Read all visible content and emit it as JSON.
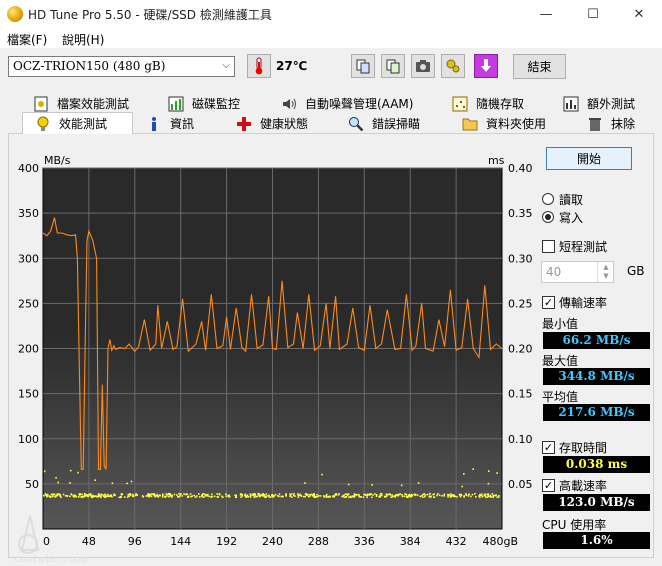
{
  "window": {
    "title": "HD Tune Pro 5.50 - 硬碟/SSD 檢測維護工具",
    "minimize": "—",
    "maximize": "☐",
    "close": "✕"
  },
  "menu": [
    "檔案(F)",
    "說明(H)"
  ],
  "toolbar": {
    "drive": "OCZ-TRION150 (480 gB)",
    "temperature": "27℃",
    "exit_label": "結束"
  },
  "tabs_top": [
    "檔案效能測試",
    "磁碟監控",
    "自動噪聲管理(AAM)",
    "隨機存取",
    "額外測試"
  ],
  "tabs_bottom": [
    "效能測試",
    "資訊",
    "健康狀態",
    "錯誤掃瞄",
    "資料夾使用",
    "抹除"
  ],
  "chart": {
    "left_unit": "MB/s",
    "right_unit": "ms",
    "y_left_ticks": [
      "400",
      "350",
      "300",
      "250",
      "200",
      "150",
      "100",
      "50"
    ],
    "y_right_ticks": [
      "0.40",
      "0.35",
      "0.30",
      "0.25",
      "0.20",
      "0.15",
      "0.10",
      "0.05"
    ],
    "x_ticks": [
      "0",
      "48",
      "96",
      "144",
      "192",
      "240",
      "288",
      "336",
      "384",
      "432",
      "480gB"
    ]
  },
  "chart_data": {
    "type": "line",
    "x_range": [
      0,
      480
    ],
    "x_unit": "gB",
    "y_left_range": [
      0,
      400
    ],
    "y_right_range": [
      0,
      0.4
    ],
    "grid": true,
    "series": [
      {
        "color": "#ff8a1a",
        "axis": "left",
        "x": [
          0,
          4,
          8,
          12,
          15,
          20,
          25,
          30,
          34,
          36,
          38,
          40,
          42,
          44,
          46,
          48,
          50,
          52,
          54,
          56,
          58,
          60,
          62,
          64,
          66,
          68,
          70,
          72,
          74,
          76,
          80,
          86,
          90,
          96,
          100,
          106,
          112,
          118,
          120,
          124,
          130,
          136,
          140,
          146,
          152,
          160,
          166,
          170,
          176,
          182,
          188,
          192,
          196,
          202,
          208,
          212,
          218,
          224,
          230,
          236,
          240,
          244,
          250,
          256,
          262,
          266,
          272,
          278,
          284,
          290,
          296,
          300,
          306,
          310,
          318,
          324,
          330,
          336,
          342,
          348,
          354,
          360,
          368,
          374,
          380,
          386,
          390,
          396,
          400,
          408,
          414,
          420,
          426,
          432,
          438,
          444,
          450,
          456,
          462,
          468,
          474,
          480
        ],
        "y": [
          328,
          325,
          330,
          345,
          328,
          328,
          326,
          325,
          326,
          300,
          180,
          66,
          66,
          200,
          320,
          330,
          325,
          320,
          310,
          300,
          66,
          66,
          160,
          70,
          66,
          200,
          210,
          198,
          203,
          199,
          201,
          200,
          205,
          197,
          202,
          232,
          198,
          205,
          248,
          200,
          230,
          199,
          202,
          255,
          197,
          205,
          230,
          198,
          260,
          200,
          203,
          235,
          199,
          245,
          201,
          197,
          260,
          200,
          204,
          258,
          200,
          199,
          275,
          201,
          205,
          240,
          200,
          260,
          198,
          203,
          250,
          200,
          258,
          199,
          205,
          245,
          201,
          198,
          248,
          200,
          205,
          243,
          199,
          200,
          260,
          198,
          203,
          250,
          200,
          197,
          232,
          202,
          265,
          198,
          201,
          255,
          200,
          190,
          270,
          199,
          205,
          200
        ]
      },
      {
        "color": "#ffff40",
        "axis": "right",
        "x": [
          0,
          480
        ],
        "y": [
          0.038,
          0.038
        ]
      }
    ]
  },
  "panel": {
    "start_label": "開始",
    "read_label": "讀取",
    "write_label": "寫入",
    "mode": "write",
    "short_test_label": "短程測試",
    "short_test_checked": false,
    "size_value": "40",
    "size_unit": "GB",
    "transfer_label": "傳輸速率",
    "transfer_checked": true,
    "min_label": "最小值",
    "min_value": "66.2 MB/s",
    "max_label": "最大值",
    "max_value": "344.8 MB/s",
    "avg_label": "平均值",
    "avg_value": "217.6 MB/s",
    "access_label": "存取時間",
    "access_checked": true,
    "access_value": "0.038 ms",
    "burst_label": "高載速率",
    "burst_checked": true,
    "burst_value": "123.0 MB/s",
    "cpu_label": "CPU 使用率",
    "cpu_value": "1.6%"
  },
  "watermark": "coolaler.com"
}
